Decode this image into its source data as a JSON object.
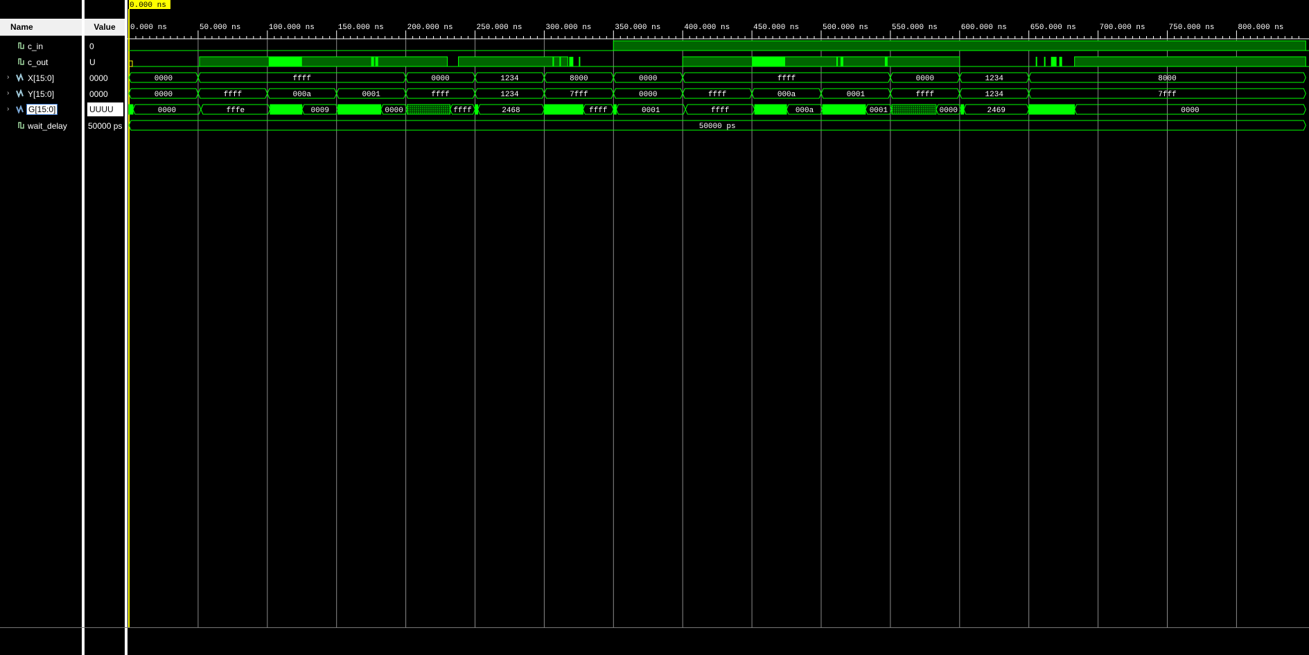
{
  "header": {
    "name_label": "Name",
    "value_label": "Value"
  },
  "cursor": {
    "label": "0.000 ns"
  },
  "time_axis": {
    "unit": "ns",
    "ticks": [
      "0.000 ns",
      "50.000 ns",
      "100.000 ns",
      "150.000 ns",
      "200.000 ns",
      "250.000 ns",
      "300.000 ns",
      "350.000 ns",
      "400.000 ns",
      "450.000 ns",
      "500.000 ns",
      "550.000 ns",
      "600.000 ns",
      "650.000 ns",
      "700.000 ns",
      "750.000 ns",
      "800.000 ns"
    ]
  },
  "signals": [
    {
      "name": "c_in",
      "value": "0",
      "kind": "bit"
    },
    {
      "name": "c_out",
      "value": "U",
      "kind": "bit"
    },
    {
      "name": "X[15:0]",
      "value": "0000",
      "kind": "bus"
    },
    {
      "name": "Y[15:0]",
      "value": "0000",
      "kind": "bus"
    },
    {
      "name": "G[15:0]",
      "value": "UUUU",
      "kind": "bus",
      "selected": true
    },
    {
      "name": "wait_delay",
      "value": "50000 ps",
      "kind": "bit"
    }
  ],
  "waveforms": {
    "c_in": {
      "high_from_ns": 350
    },
    "c_out": {
      "high_segments_ns": [
        [
          51,
          230
        ],
        [
          238,
          317
        ],
        [
          400,
          600
        ],
        [
          683,
          850
        ]
      ],
      "glitches_ns": [
        [
          101,
          125
        ],
        [
          175,
          177
        ],
        [
          178,
          180
        ],
        [
          306,
          307
        ],
        [
          311,
          312
        ],
        [
          318,
          321
        ],
        [
          325,
          326
        ],
        [
          450,
          474
        ],
        [
          511,
          512
        ],
        [
          514,
          516
        ],
        [
          546,
          548
        ],
        [
          655,
          656
        ],
        [
          661,
          662
        ],
        [
          666,
          670
        ],
        [
          672,
          674
        ]
      ]
    },
    "X": [
      {
        "from": 0,
        "to": 50,
        "label": "0000"
      },
      {
        "from": 50,
        "to": 200,
        "label": "ffff"
      },
      {
        "from": 200,
        "to": 250,
        "label": "0000"
      },
      {
        "from": 250,
        "to": 300,
        "label": "1234"
      },
      {
        "from": 300,
        "to": 350,
        "label": "8000"
      },
      {
        "from": 350,
        "to": 400,
        "label": "0000"
      },
      {
        "from": 400,
        "to": 550,
        "label": "ffff"
      },
      {
        "from": 550,
        "to": 600,
        "label": "0000"
      },
      {
        "from": 600,
        "to": 650,
        "label": "1234"
      },
      {
        "from": 650,
        "to": 850,
        "label": "8000"
      }
    ],
    "Y": [
      {
        "from": 0,
        "to": 50,
        "label": "0000"
      },
      {
        "from": 50,
        "to": 100,
        "label": "ffff"
      },
      {
        "from": 100,
        "to": 150,
        "label": "000a"
      },
      {
        "from": 150,
        "to": 200,
        "label": "0001"
      },
      {
        "from": 200,
        "to": 250,
        "label": "ffff"
      },
      {
        "from": 250,
        "to": 300,
        "label": "1234"
      },
      {
        "from": 300,
        "to": 350,
        "label": "7fff"
      },
      {
        "from": 350,
        "to": 400,
        "label": "0000"
      },
      {
        "from": 400,
        "to": 450,
        "label": "ffff"
      },
      {
        "from": 450,
        "to": 500,
        "label": "000a"
      },
      {
        "from": 500,
        "to": 550,
        "label": "0001"
      },
      {
        "from": 550,
        "to": 600,
        "label": "ffff"
      },
      {
        "from": 600,
        "to": 650,
        "label": "1234"
      },
      {
        "from": 650,
        "to": 850,
        "label": "7fff"
      }
    ],
    "G": [
      {
        "from": 0,
        "to": 3,
        "type": "solid"
      },
      {
        "from": 3,
        "to": 52,
        "label": "0000"
      },
      {
        "from": 52,
        "to": 102,
        "label": "fffe"
      },
      {
        "from": 102,
        "to": 125,
        "type": "solid"
      },
      {
        "from": 125,
        "to": 151,
        "label": "0009"
      },
      {
        "from": 151,
        "to": 182,
        "type": "solid"
      },
      {
        "from": 182,
        "to": 201,
        "label": "0000"
      },
      {
        "from": 201,
        "to": 232,
        "type": "hatched"
      },
      {
        "from": 232,
        "to": 250,
        "label": "ffff"
      },
      {
        "from": 250,
        "to": 252,
        "type": "solid"
      },
      {
        "from": 252,
        "to": 300,
        "label": "2468"
      },
      {
        "from": 300,
        "to": 328,
        "type": "solid"
      },
      {
        "from": 328,
        "to": 350,
        "label": "ffff"
      },
      {
        "from": 350,
        "to": 352,
        "type": "solid"
      },
      {
        "from": 352,
        "to": 402,
        "label": "0001"
      },
      {
        "from": 402,
        "to": 452,
        "label": "ffff"
      },
      {
        "from": 452,
        "to": 475,
        "type": "solid"
      },
      {
        "from": 475,
        "to": 501,
        "label": "000a"
      },
      {
        "from": 501,
        "to": 532,
        "type": "solid"
      },
      {
        "from": 532,
        "to": 551,
        "label": "0001"
      },
      {
        "from": 551,
        "to": 583,
        "type": "hatched"
      },
      {
        "from": 583,
        "to": 601,
        "label": "0000"
      },
      {
        "from": 601,
        "to": 603,
        "type": "solid"
      },
      {
        "from": 603,
        "to": 650,
        "label": "2469"
      },
      {
        "from": 650,
        "to": 683,
        "type": "solid"
      },
      {
        "from": 683,
        "to": 850,
        "label": "0000"
      }
    ],
    "wait_delay": {
      "label": "50000 ps"
    }
  },
  "colors": {
    "wave": "#00ff00",
    "wave_dark": "#006400",
    "cursor": "#ffff00",
    "grid": "#8c8c8c",
    "background": "#000000"
  }
}
